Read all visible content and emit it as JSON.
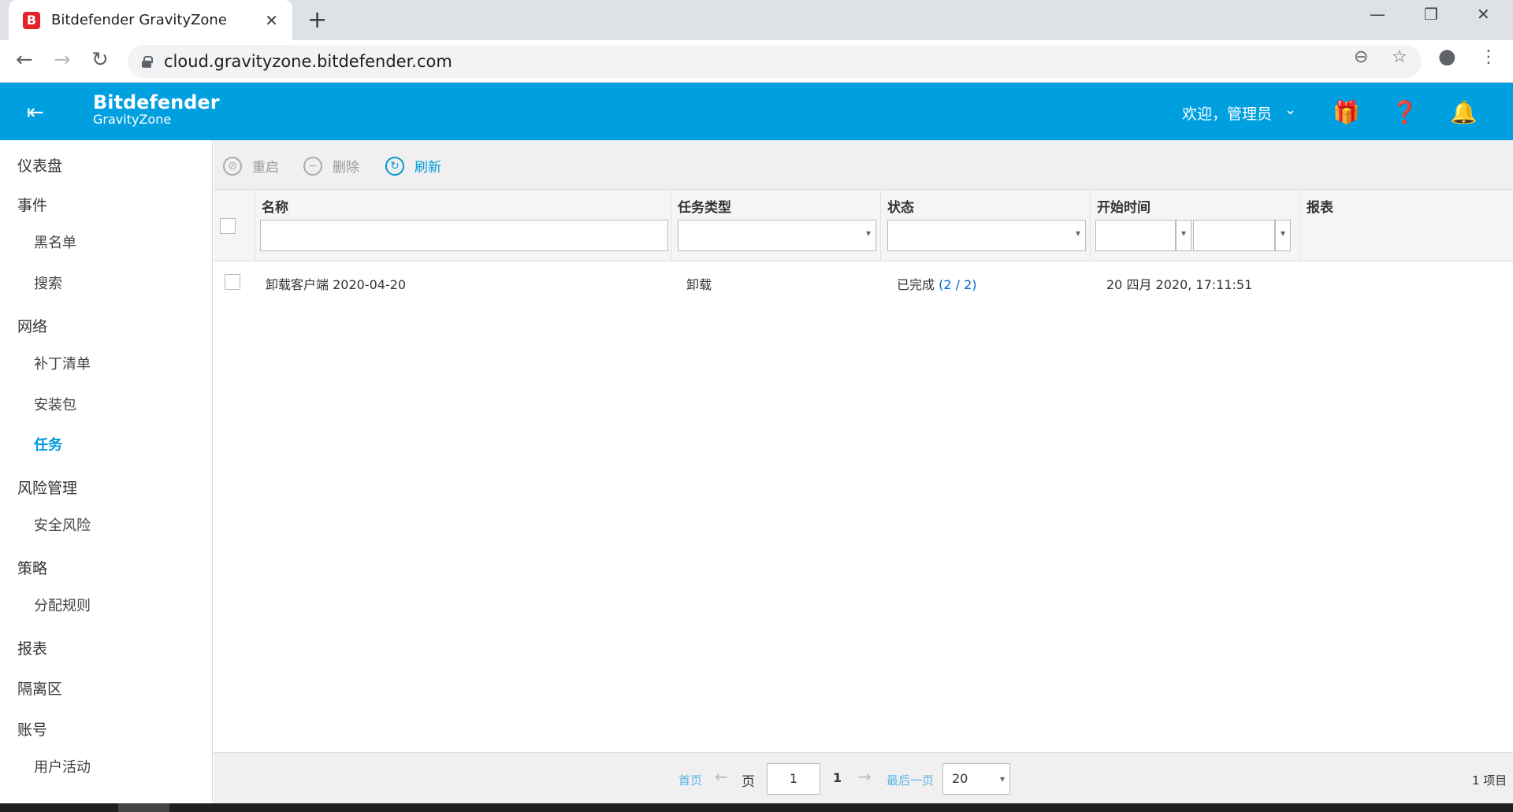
{
  "browser": {
    "tab_title": "Bitdefender GravityZone",
    "favicon_letter": "B",
    "url": "cloud.gravityzone.bitdefender.com"
  },
  "header": {
    "brand_name": "Bitdefender",
    "product_name": "GravityZone",
    "welcome_text": "欢迎，管理员",
    "accent_color": "#00a0e0"
  },
  "sidebar": {
    "items": [
      {
        "label": "仪表盘",
        "level": 0
      },
      {
        "label": "事件",
        "level": 0
      },
      {
        "label": "黑名单",
        "level": 1
      },
      {
        "label": "搜索",
        "level": 1
      },
      {
        "label": "网络",
        "level": 0
      },
      {
        "label": "补丁清单",
        "level": 1
      },
      {
        "label": "安装包",
        "level": 1
      },
      {
        "label": "任务",
        "level": 1,
        "active": true
      },
      {
        "label": "风险管理",
        "level": 0
      },
      {
        "label": "安全风险",
        "level": 1
      },
      {
        "label": "策略",
        "level": 0
      },
      {
        "label": "分配规则",
        "level": 1
      },
      {
        "label": "报表",
        "level": 0
      },
      {
        "label": "隔离区",
        "level": 0
      },
      {
        "label": "账号",
        "level": 0
      },
      {
        "label": "用户活动",
        "level": 1
      }
    ]
  },
  "toolbar": {
    "restart_label": "重启",
    "delete_label": "删除",
    "refresh_label": "刷新"
  },
  "grid": {
    "columns": [
      "名称",
      "任务类型",
      "状态",
      "开始时间",
      "报表"
    ],
    "rows": [
      {
        "name": "卸载客户端 2020-04-20",
        "type": "卸载",
        "status": "已完成",
        "status_count": "(2 / 2)",
        "start_time": "20 四月 2020, 17:11:51"
      }
    ]
  },
  "pagination": {
    "first_label": "首页",
    "prev_arrow": "←",
    "page_label": "页",
    "current_page": "1",
    "total_pages": "1",
    "next_arrow": "→",
    "last_label": "最后一页",
    "page_size": "20",
    "item_count": "1 项目"
  }
}
